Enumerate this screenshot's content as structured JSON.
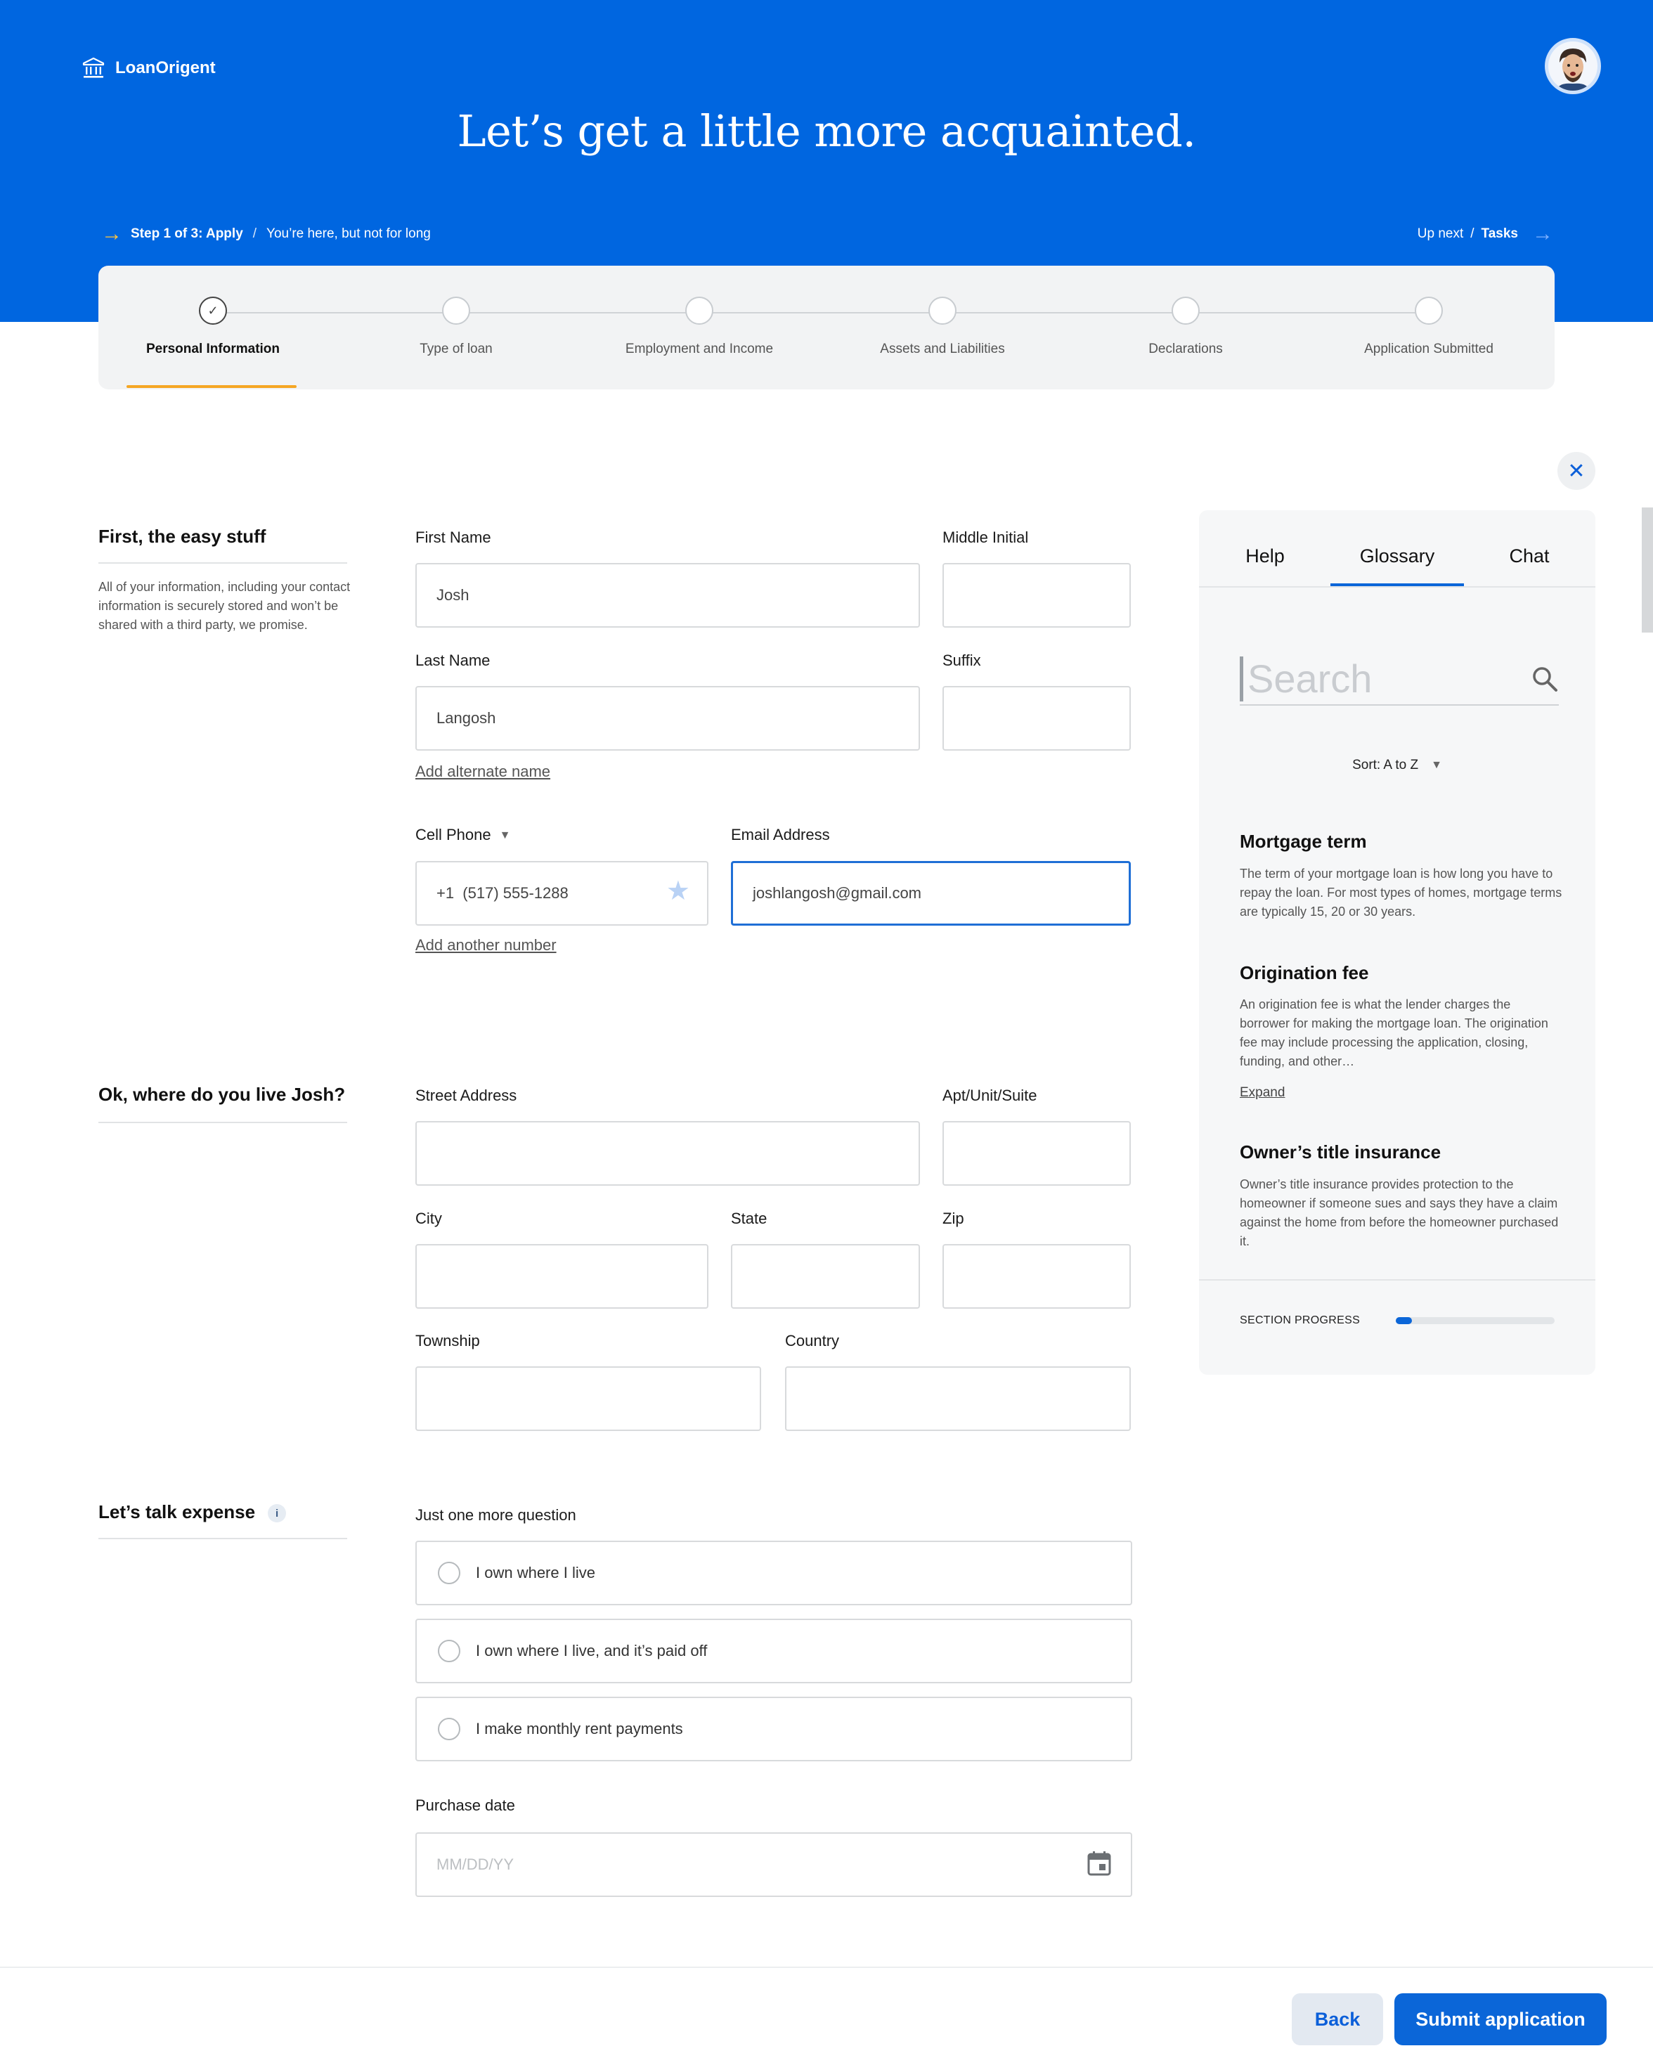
{
  "header": {
    "brand": "LoanOrigent",
    "logo_icon": "bank-icon",
    "title": "Let’s get a little more acquainted.",
    "step_label": "Step 1 of 3: Apply",
    "step_sep": "/",
    "step_note": "You’re here, but not for long",
    "upnext_label": "Up next",
    "upnext_sep": "/",
    "upnext_value": "Tasks",
    "colors": {
      "brand_blue": "#0066e0",
      "accent_yellow": "#f5a623"
    }
  },
  "stepper": {
    "steps": [
      {
        "label": "Personal Information",
        "state": "complete"
      },
      {
        "label": "Type of loan",
        "state": "pending"
      },
      {
        "label": "Employment and Income",
        "state": "pending"
      },
      {
        "label": "Assets and Liabilities",
        "state": "pending"
      },
      {
        "label": "Declarations",
        "state": "pending"
      },
      {
        "label": "Application Submitted",
        "state": "pending"
      }
    ],
    "active_index": 0,
    "check_glyph": "✓"
  },
  "close_glyph": "✕",
  "section_personal": {
    "title": "First, the easy stuff",
    "description": "All of your information, including your contact information is securely stored and won’t be shared with a third party, we promise.",
    "first_name": {
      "label": "First Name",
      "value": "Josh"
    },
    "middle_initial": {
      "label": "Middle Initial",
      "value": ""
    },
    "last_name": {
      "label": "Last Name",
      "value": "Langosh"
    },
    "suffix": {
      "label": "Suffix",
      "value": ""
    },
    "add_alternate_name": "Add alternate name",
    "cell_phone": {
      "label": "Cell Phone",
      "value": "+1  (517) 555-1288"
    },
    "email": {
      "label": "Email Address",
      "value": "joshlangosh@gmail.com"
    },
    "add_another_number": "Add another number"
  },
  "section_address": {
    "title": "Ok, where do you live Josh?",
    "street": {
      "label": "Street Address",
      "value": ""
    },
    "apt": {
      "label": "Apt/Unit/Suite",
      "value": ""
    },
    "city": {
      "label": "City",
      "value": ""
    },
    "state": {
      "label": "State",
      "value": ""
    },
    "zip": {
      "label": "Zip",
      "value": ""
    },
    "township": {
      "label": "Township",
      "value": ""
    },
    "country": {
      "label": "Country",
      "value": ""
    }
  },
  "section_expense": {
    "title": "Let’s talk expense",
    "info_glyph": "i",
    "question": "Just one more question",
    "options": [
      {
        "label": "I own where I live",
        "selected": false
      },
      {
        "label": "I own where I live, and it’s paid off",
        "selected": false
      },
      {
        "label": "I make monthly rent payments",
        "selected": false
      }
    ],
    "purchase_date": {
      "label": "Purchase date",
      "placeholder": "MM/DD/YY"
    }
  },
  "panel": {
    "tabs": [
      "Help",
      "Glossary",
      "Chat"
    ],
    "active_tab": "Glossary",
    "search_placeholder": "Search",
    "sort_label": "Sort: A to Z",
    "terms": [
      {
        "title": "Mortgage term",
        "description": "The term of your mortgage loan is how long you have to repay the loan. For most types of homes, mortgage terms are typically 15, 20 or 30 years."
      },
      {
        "title": "Origination fee",
        "description": "An origination fee is what the lender charges the borrower for making the mortgage loan. The origination fee may include processing the application, closing, funding, and other…",
        "link": "Expand"
      },
      {
        "title": "Owner’s title insurance",
        "description": "Owner’s title insurance provides protection to the homeowner if someone sues and says they have a claim against the home from before the homeowner purchased it."
      }
    ],
    "progress_label": "SECTION PROGRESS",
    "progress_fraction": 0.1
  },
  "footer": {
    "back_label": "Back",
    "submit_label": "Submit application"
  }
}
